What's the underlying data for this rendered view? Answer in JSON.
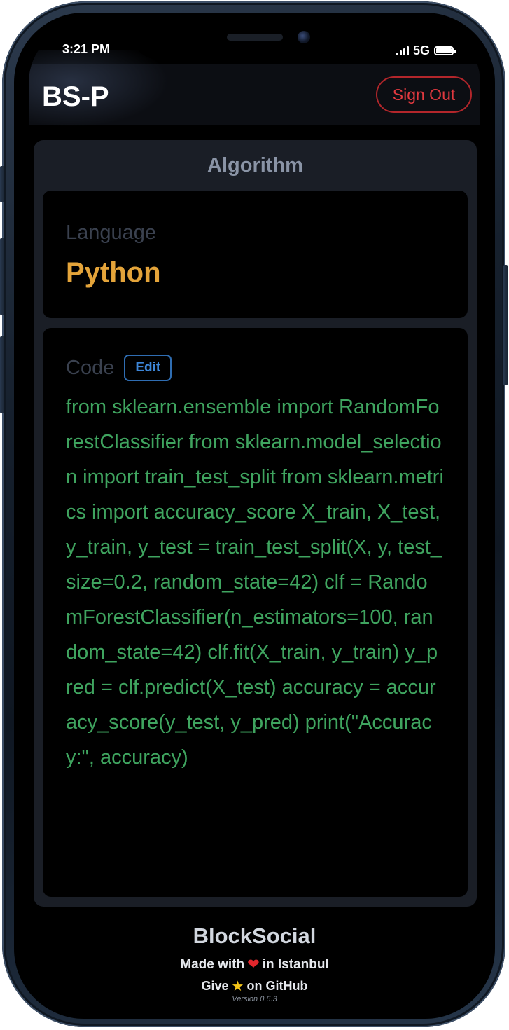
{
  "status_bar": {
    "time": "3:21 PM",
    "network": "5G"
  },
  "header": {
    "brand": "BS-P",
    "sign_out_label": "Sign Out"
  },
  "panel": {
    "title": "Algorithm",
    "language": {
      "label": "Language",
      "value": "Python"
    },
    "code": {
      "label": "Code",
      "edit_label": "Edit",
      "content": "from sklearn.ensemble import RandomForestClassifier from sklearn.model_selection import train_test_split from sklearn.metrics import accuracy_score X_train, X_test, y_train, y_test = train_test_split(X, y, test_size=0.2, random_state=42) clf = RandomForestClassifier(n_estimators=100, random_state=42) clf.fit(X_train, y_train) y_pred = clf.predict(X_test) accuracy = accuracy_score(y_test, y_pred) print(\"Accuracy:\", accuracy)"
    }
  },
  "footer": {
    "brand": "BlockSocial",
    "made_prefix": "Made with",
    "made_suffix": "in Istanbul",
    "give_prefix": "Give",
    "give_suffix": "on GitHub",
    "version": "Version 0.6.3"
  },
  "colors": {
    "language_value": "#e4a43a",
    "code_text": "#3fa45f",
    "sign_out": "#e0393f",
    "edit": "#3d86d8"
  }
}
